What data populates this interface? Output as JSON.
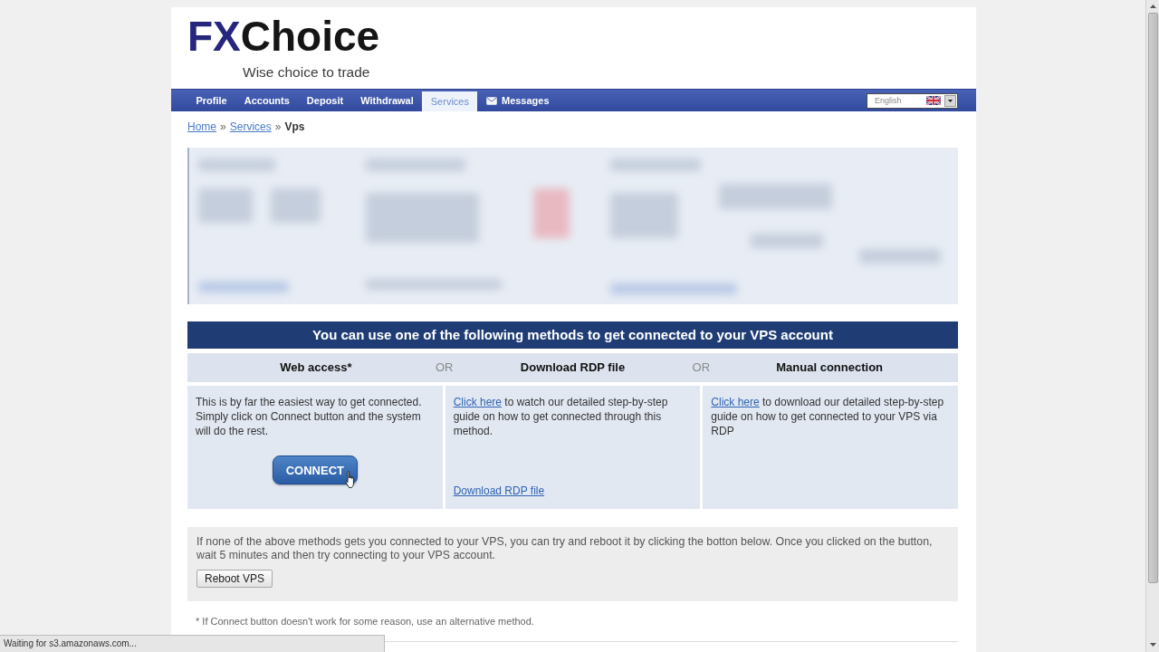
{
  "header": {
    "logo": {
      "prefix": "FX",
      "name": "Choice"
    },
    "tagline": "Wise choice to trade"
  },
  "nav": {
    "tabs": [
      {
        "label": "Profile",
        "selected": false,
        "kind": "plain"
      },
      {
        "label": "Accounts",
        "selected": false,
        "kind": "plain"
      },
      {
        "label": "Deposit",
        "selected": false,
        "kind": "plain"
      },
      {
        "label": "Withdrawal",
        "selected": false,
        "kind": "plain"
      },
      {
        "label": "Services",
        "selected": true,
        "kind": "plain"
      },
      {
        "label": "Messages",
        "selected": false,
        "kind": "mail"
      }
    ],
    "language": {
      "value": "English"
    }
  },
  "breadcrumb": [
    {
      "kind": "link",
      "label": "Home"
    },
    {
      "kind": "separator",
      "label": "»"
    },
    {
      "kind": "link",
      "label": "Services"
    },
    {
      "kind": "separator",
      "label": "»"
    },
    {
      "kind": "current",
      "label": "Vps"
    }
  ],
  "methods": {
    "title": "You can use one of the following methods to get connected to your VPS account",
    "header_row": [
      {
        "kind": "heading",
        "text": "Web access*"
      },
      {
        "kind": "or",
        "text": "OR"
      },
      {
        "kind": "heading",
        "text": "Download RDP file"
      },
      {
        "kind": "or",
        "text": "OR"
      },
      {
        "kind": "heading",
        "text": "Manual connection"
      }
    ],
    "cells": [
      {
        "description": [
          {
            "kind": "text",
            "text": "This is by far the easiest way to get connected. Simply click on Connect button and the system will do the rest."
          }
        ],
        "button": "CONNECT"
      },
      {
        "description": [
          {
            "kind": "link",
            "text": "Click here"
          },
          {
            "kind": "text",
            "text": " to watch our detailed step-by-step guide on how to get connected through this method."
          }
        ],
        "link": "Download RDP file"
      },
      {
        "description": [
          {
            "kind": "link",
            "text": "Click here"
          },
          {
            "kind": "text",
            "text": " to download our detailed step-by-step guide on how to get connected to your VPS via RDP"
          }
        ]
      }
    ]
  },
  "reboot": {
    "text": "If none of the above methods gets you connected to your VPS, you can try and reboot it by clicking the botton below. Once you clicked on the button, wait 5 minutes and then try connecting to your VPS account.",
    "button": "Reboot VPS"
  },
  "footnote": "* If Connect button doesn't work for some reason, use an alternative method.",
  "status_bar": {
    "text": "Waiting for s3.amazonaws.com..."
  }
}
